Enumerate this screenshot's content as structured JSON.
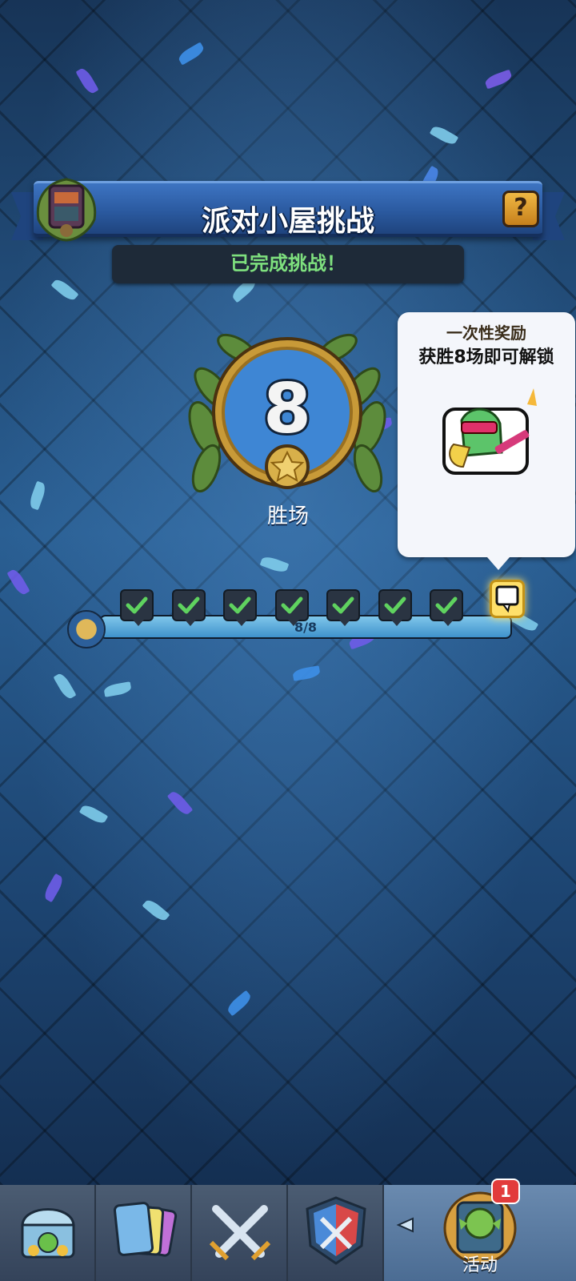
{
  "challenge": {
    "title": "派对小屋挑战",
    "status": "已完成挑战！",
    "help_icon": "?"
  },
  "wins": {
    "count": "8",
    "label": "胜场"
  },
  "reward_tooltip": {
    "title": "一次性奖励",
    "subtitle": "获胜8场即可解锁"
  },
  "progress": {
    "text": "8/8",
    "completed": 8,
    "total": 8
  },
  "nav": {
    "tabs": [
      {
        "icon": "chest-shop-icon"
      },
      {
        "icon": "cards-icon"
      },
      {
        "icon": "crossed-swords-icon"
      },
      {
        "icon": "clan-shield-icon"
      },
      {
        "icon": "goblin-events-icon",
        "label": "活动",
        "badge": "1"
      }
    ]
  },
  "colors": {
    "accent_green": "#7ee07e",
    "banner_blue": "#2b5aa0",
    "gold": "#f0b844",
    "badge_red": "#e23b3b"
  }
}
